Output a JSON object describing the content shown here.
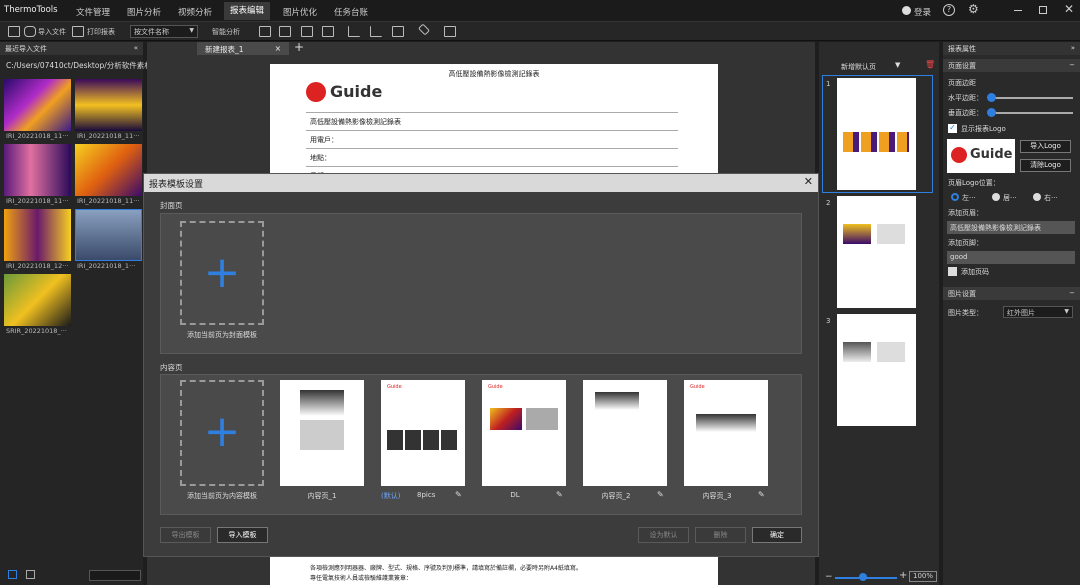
{
  "app": {
    "title": "ThermoTools",
    "login": "登录"
  },
  "menu": [
    "文件管理",
    "图片分析",
    "视频分析",
    "报表编辑",
    "图片优化",
    "任务台账"
  ],
  "toolbar": {
    "import": "导入文件",
    "print": "打印报表",
    "combo": "按文件名称",
    "smart": "智能分析"
  },
  "left": {
    "header": "最近导入文件",
    "path": "C:/Users/07410ct/Desktop/分析软件素材",
    "files": [
      "IRI_20221018_11···",
      "IRI_20221018_11···",
      "IRI_20221018_11···",
      "IRI_20221018_11···",
      "IRI_20221018_12···",
      "IRI_20221018_1···",
      "SRIR_20221018_···"
    ]
  },
  "tabs": {
    "doc": "新建报表_1"
  },
  "doc": {
    "header": "高低壓設備熱影像檢測記錄表",
    "logo": "Guide",
    "fields": [
      "高低壓設備熱影像檢測記錄表",
      "用電戶：",
      "地點：",
      "日期："
    ],
    "footer_lines": [
      "各項檢測應列明器器、廠牌、型式、規格、序號及判別標準，請填寫於備註欄，必要時另附A4紙填寫。",
      "專任電氣技術人員或檢驗維護業簽章："
    ]
  },
  "pages_panel": {
    "new_default": "新增默认页",
    "pages": [
      "1",
      "2",
      "3"
    ],
    "zoom": "100%"
  },
  "right": {
    "header": "报表属性",
    "page_settings": "页面设置",
    "margin": "页面边距",
    "h_margin": "水平边距：",
    "v_margin": "垂直边距：",
    "show_logo": "显示报表Logo",
    "import_logo": "导入Logo",
    "clear_logo": "清除Logo",
    "logo_pos": "页眉Logo位置：",
    "pos_options": [
      "左···",
      "居···",
      "右···"
    ],
    "add_header": "添加页眉：",
    "header_value": "高低壓設備熱影像檢測記錄表",
    "add_footer": "添加页脚：",
    "footer_value": "good",
    "add_pageno": "添加页码",
    "img_settings": "图片设置",
    "img_type": "图片类型：",
    "img_type_value": "红外图片",
    "h_margin_level": 0.05,
    "v_margin_level": 0.05
  },
  "modal": {
    "title": "报表模板设置",
    "cover_section": "封面页",
    "cover_add": "添加当前页为封面模板",
    "content_section": "内容页",
    "content_add": "添加当前页为内容模板",
    "templates": [
      {
        "name": "内容页_1",
        "default": ""
      },
      {
        "name": "8pics",
        "default": "(默认)"
      },
      {
        "name": "DL",
        "default": ""
      },
      {
        "name": "内容页_2",
        "default": ""
      },
      {
        "name": "内容页_3",
        "default": ""
      }
    ],
    "export": "导出模板",
    "import": "导入模板",
    "set_default": "设为默认",
    "delete": "删除",
    "ok": "确定"
  },
  "colors": {
    "accent": "#2f7fe0",
    "logo_red": "#d22"
  }
}
